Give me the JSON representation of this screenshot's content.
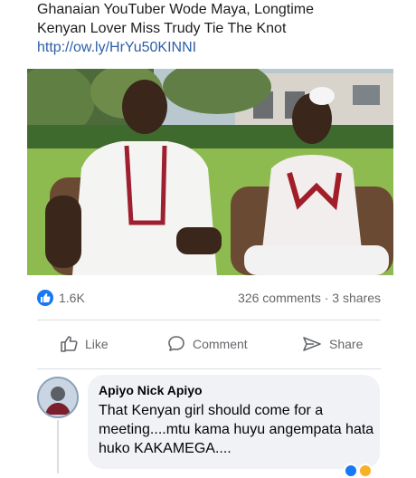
{
  "post": {
    "line1": "Ghanaian YouTuber Wode Maya, Longtime",
    "line2": "Kenyan Lover Miss Trudy Tie The Knot",
    "link": "http://ow.ly/HrYu50KINNI"
  },
  "stats": {
    "likes": "1.6K",
    "comments_shares": "326 comments · 3 shares"
  },
  "actions": {
    "like": "Like",
    "comment": "Comment",
    "share": "Share"
  },
  "comment": {
    "author": "Apiyo Nick Apiyo",
    "text": "That Kenyan girl should come for a meeting....mtu kama huyu angempata hata huko KAKAMEGA...."
  },
  "colors": {
    "like_blue": "#1877f2",
    "link": "#2d5fa6",
    "muted": "#65676b"
  },
  "icons": [
    "like-icon",
    "comment-icon",
    "share-icon"
  ]
}
